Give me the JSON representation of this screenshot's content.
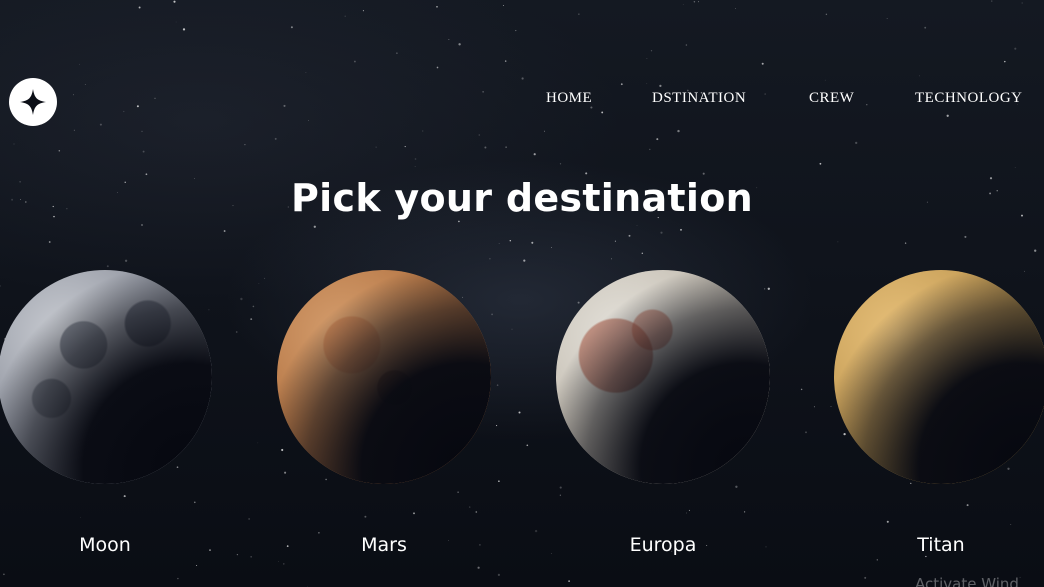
{
  "header": {
    "logo_icon": "four-point-star-icon",
    "nav": [
      {
        "label": "HOME"
      },
      {
        "label": "DSTINATION"
      },
      {
        "label": "CREW"
      },
      {
        "label": "TECHNOLOGY"
      }
    ]
  },
  "main": {
    "title": "Pick your destination",
    "planets": [
      {
        "name": "Moon",
        "color": "#9a9ea8"
      },
      {
        "name": "Mars",
        "color": "#b97b4a"
      },
      {
        "name": "Europa",
        "color": "#c9c3b8"
      },
      {
        "name": "Titan",
        "color": "#c9a15a"
      }
    ]
  },
  "overlay": {
    "watermark": "Activate Wind"
  }
}
